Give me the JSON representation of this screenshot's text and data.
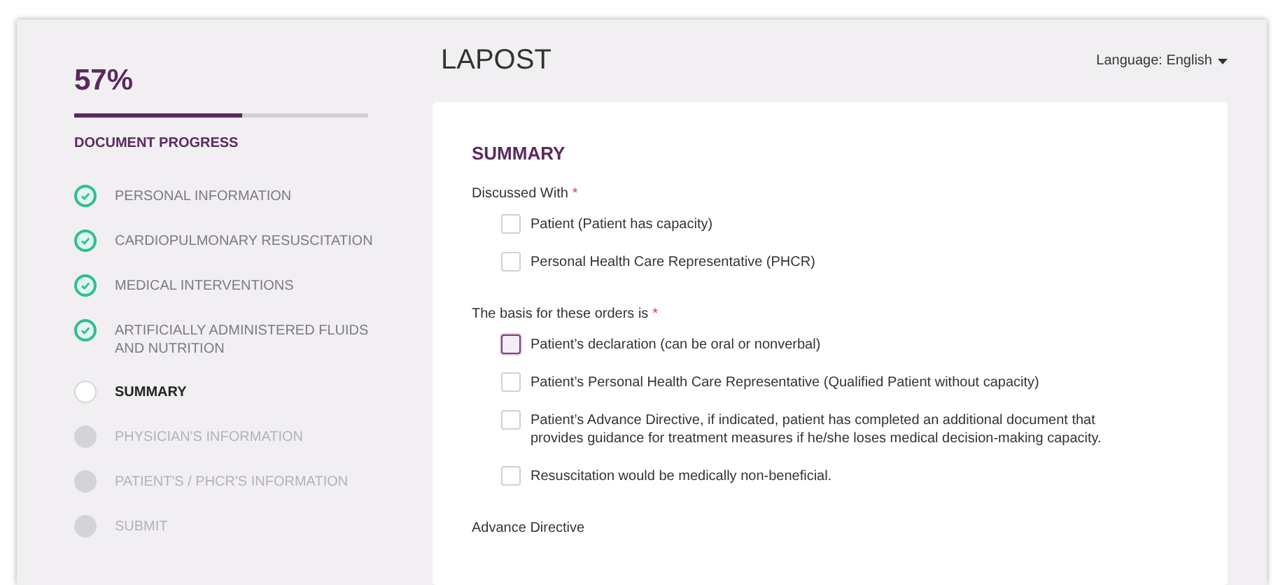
{
  "progress": {
    "percent": "57%",
    "level": 0.57,
    "label": "DOCUMENT PROGRESS"
  },
  "steps": [
    {
      "label": "PERSONAL INFORMATION",
      "completed": true,
      "current": false
    },
    {
      "label": "CARDIOPULMONARY RESUSCITATION",
      "completed": true,
      "current": false
    },
    {
      "label": "MEDICAL INTERVENTIONS",
      "completed": true,
      "current": false
    },
    {
      "label": "ARTIFICIALLY ADMINISTERED FLUIDS AND NUTRITION",
      "completed": true,
      "current": false
    },
    {
      "label": "SUMMARY",
      "completed": false,
      "current": true
    },
    {
      "label": "PHYSICIAN'S INFORMATION",
      "completed": false,
      "current": false
    },
    {
      "label": "PATIENT'S / PHCR'S INFORMATION",
      "completed": false,
      "current": false
    },
    {
      "label": "SUBMIT",
      "completed": false,
      "current": false
    }
  ],
  "header": {
    "title": "LAPOST",
    "language": "Language: English"
  },
  "form": {
    "title": "SUMMARY",
    "groups": [
      {
        "label": "Discussed With",
        "required_mark": "*",
        "options": [
          {
            "label": "Patient (Patient has capacity)",
            "checked": false,
            "focused": false
          },
          {
            "label": "Personal Health Care Representative (PHCR)",
            "checked": false,
            "focused": false
          }
        ]
      },
      {
        "label": "The basis for these orders is",
        "required_mark": "*",
        "options": [
          {
            "label": "Patient’s declaration (can be oral or nonverbal)",
            "checked": false,
            "focused": true
          },
          {
            "label": "Patient’s Personal Health Care Representative (Qualified Patient without capacity)",
            "checked": false,
            "focused": false
          },
          {
            "label": "Patient’s Advance Directive, if indicated, patient has completed an additional document that provides guidance for treatment measures if he/she loses medical decision-making capacity.",
            "checked": false,
            "focused": false
          },
          {
            "label": "Resuscitation would be medically non-beneficial.",
            "checked": false,
            "focused": false
          }
        ]
      },
      {
        "label": "Advance Directive"
      }
    ]
  }
}
